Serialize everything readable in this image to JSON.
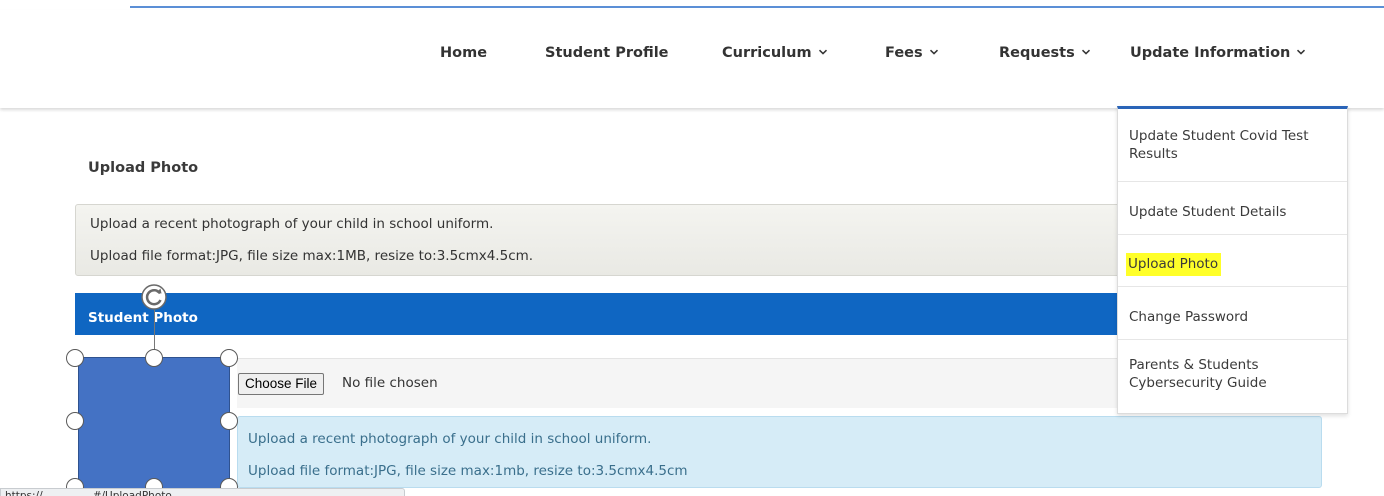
{
  "nav": {
    "home": "Home",
    "student_profile": "Student Profile",
    "curriculum": "Curriculum",
    "fees": "Fees",
    "requests": "Requests",
    "update_information": "Update Information"
  },
  "page": {
    "title": "Upload Photo"
  },
  "instructions": {
    "line1": "Upload a recent photograph of your child in school uniform.",
    "line2": "Upload file format:JPG, file size max:1MB, resize to:3.5cmx4.5cm."
  },
  "panel": {
    "title": "Student Photo",
    "choose_file_label": "Choose File",
    "no_file_text": "No file chosen",
    "alert_line1": "Upload a recent photograph of your child in school uniform.",
    "alert_line2": "Upload file format:JPG, file size max:1mb, resize to:3.5cmx4.5cm"
  },
  "dropdown": {
    "items": [
      {
        "label": "Update Student Covid Test Results",
        "highlighted": false
      },
      {
        "label": "Update Student Details",
        "highlighted": false
      },
      {
        "label": "Upload Photo",
        "highlighted": true
      },
      {
        "label": "Change Password",
        "highlighted": false
      },
      {
        "label": "Parents & Students Cybersecurity Guide",
        "highlighted": false
      }
    ]
  },
  "status_url": "https://...............#/UploadPhoto...",
  "colors": {
    "panel_header": "#0f66c2",
    "dropdown_accent": "#2a64b8",
    "highlight": "#ffff29",
    "shape_fill": "#4472c4",
    "alert_bg": "#d6ecf7"
  },
  "icons": {
    "chevron": "chevron-down-icon",
    "rotate": "rotate-handle-icon"
  }
}
